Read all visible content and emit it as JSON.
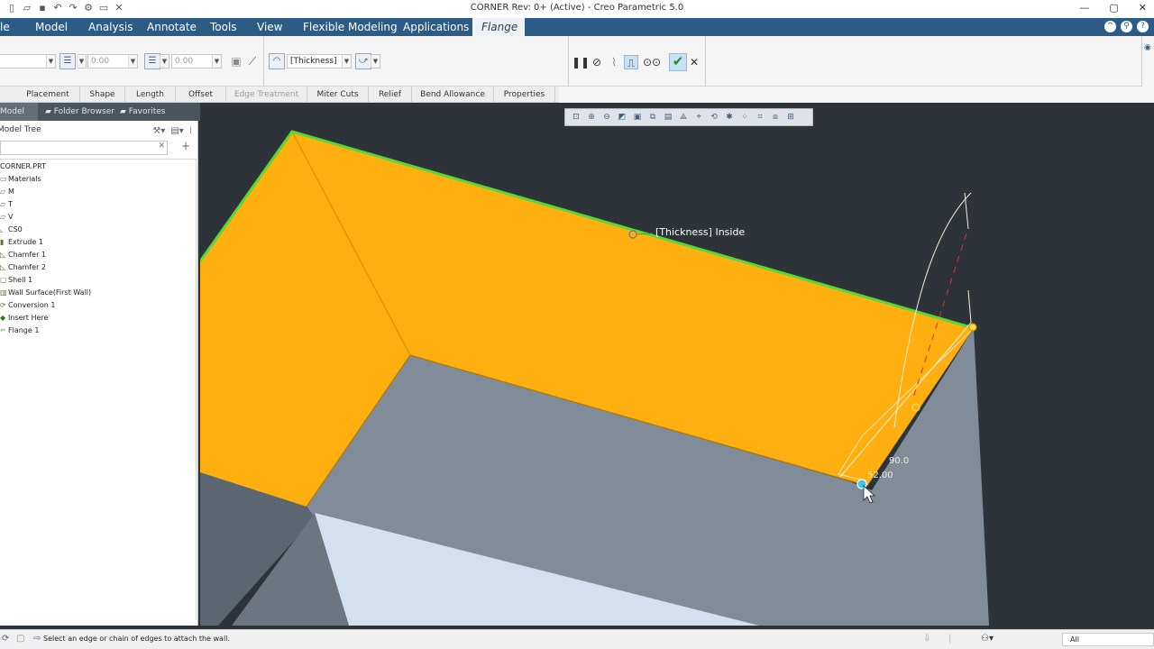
{
  "window": {
    "title": "CORNER Rev: 0+ (Active) - Creo Parametric 5.0"
  },
  "quick_access": {
    "icons": [
      "new-icon",
      "open-icon",
      "save-icon",
      "undo-icon",
      "redo-icon",
      "regenerate-icon",
      "windows-icon",
      "close-window-icon"
    ]
  },
  "ribbon": {
    "tabs": [
      {
        "label": "le"
      },
      {
        "label": "Model"
      },
      {
        "label": "Analysis"
      },
      {
        "label": "Annotate"
      },
      {
        "label": "Tools"
      },
      {
        "label": "View"
      },
      {
        "label": "Flexible Modeling"
      },
      {
        "label": "Applications"
      },
      {
        "label": "Flange",
        "active": true
      }
    ]
  },
  "dashboard": {
    "length1_value": "0.00",
    "length2_value": "0.00",
    "thickness_value": "[Thickness]",
    "controls": [
      "pause-icon",
      "stop-icon",
      "preview-glasses-icon",
      "attach-preview-icon",
      "verify-icon",
      "ok-check-icon",
      "cancel-x-icon"
    ]
  },
  "slide_tabs": [
    {
      "label": "Placement"
    },
    {
      "label": "Shape"
    },
    {
      "label": "Length"
    },
    {
      "label": "Offset"
    },
    {
      "label": "Edge Treatment",
      "disabled": true
    },
    {
      "label": "Miter Cuts"
    },
    {
      "label": "Relief"
    },
    {
      "label": "Bend Allowance"
    },
    {
      "label": "Properties"
    }
  ],
  "navigator": {
    "tabs": [
      {
        "label": "Model Tree",
        "active": true
      },
      {
        "label": "Folder Browser"
      },
      {
        "label": "Favorites"
      }
    ],
    "header": "Model Tree",
    "root": "CORNER.PRT",
    "nodes": [
      {
        "label": "Materials"
      },
      {
        "label": "M"
      },
      {
        "label": "T"
      },
      {
        "label": "V"
      },
      {
        "label": "CS0"
      },
      {
        "label": "Extrude 1"
      },
      {
        "label": "Chamfer 1"
      },
      {
        "label": "Chamfer 2"
      },
      {
        "label": "Shell 1"
      },
      {
        "label": "Wall Surface(First Wall)"
      },
      {
        "label": "Conversion 1"
      },
      {
        "label": "Insert Here"
      },
      {
        "label": "Flange 1"
      }
    ]
  },
  "graphics": {
    "thickness_annotation": "[Thickness] Inside",
    "angle_value": "90.0",
    "length_value": "52.00",
    "colors": {
      "background": "#2e333a",
      "flange_face": "#ffb010",
      "edge_highlight": "#57d83a",
      "body_gray": "#808d99",
      "body_light": "#d3e0ef",
      "handle": "#3bc3e8"
    }
  },
  "status_bar": {
    "message": "Select an edge or chain of edges to attach the wall.",
    "filter": "All"
  }
}
